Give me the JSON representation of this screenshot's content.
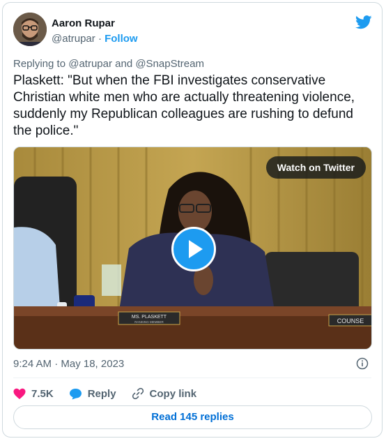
{
  "author": {
    "name": "Aaron Rupar",
    "handle": "@atrupar",
    "separator": "·",
    "follow_label": "Follow"
  },
  "reply_context": "Replying to @atrupar and @SnapStream",
  "tweet_text": "Plaskett: \"But when the FBI investigates conservative Christian white men who are actually threatening violence, suddenly my Republican colleagues are rushing to defund the police.\"",
  "media": {
    "watch_label": "Watch on Twitter",
    "nameplate_line1": "MS. PLASKETT",
    "nameplate_line2": "RANKING MEMBER",
    "counsel_sign": "COUNSE"
  },
  "timestamp": "9:24 AM · May 18, 2023",
  "actions": {
    "likes": "7.5K",
    "reply_label": "Reply",
    "copy_label": "Copy link"
  },
  "read_replies_label": "Read 145 replies",
  "colors": {
    "twitter_blue": "#1d9bf0",
    "heart_red": "#f91880",
    "secondary_text": "#536471"
  }
}
